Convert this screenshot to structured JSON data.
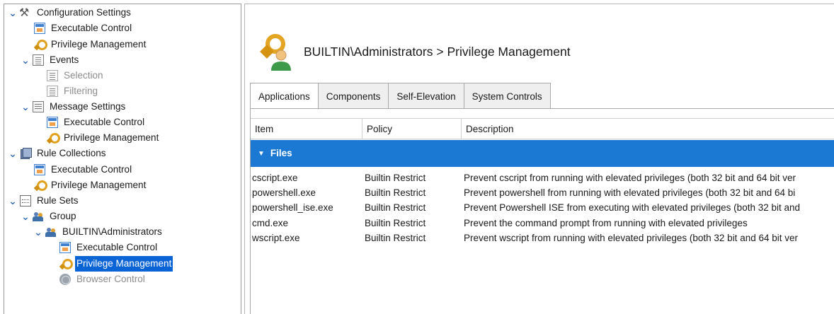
{
  "tree": {
    "items": [
      {
        "label": "Configuration Settings",
        "icon": "tools-icon",
        "level": 0,
        "expanded": true
      },
      {
        "label": "Executable Control",
        "icon": "executable-control-icon",
        "level": 1
      },
      {
        "label": "Privilege Management",
        "icon": "privilege-key-icon",
        "level": 1
      },
      {
        "label": "Events",
        "icon": "events-document-icon",
        "level": 1,
        "expanded": true
      },
      {
        "label": "Selection",
        "icon": "document-icon",
        "level": 2,
        "dim": true
      },
      {
        "label": "Filtering",
        "icon": "document-icon",
        "level": 2,
        "dim": true
      },
      {
        "label": "Message Settings",
        "icon": "message-settings-icon",
        "level": 1,
        "expanded": true
      },
      {
        "label": "Executable Control",
        "icon": "executable-control-icon",
        "level": 2
      },
      {
        "label": "Privilege Management",
        "icon": "privilege-key-icon",
        "level": 2
      },
      {
        "label": "Rule Collections",
        "icon": "rule-collections-icon",
        "level": 0,
        "expanded": true
      },
      {
        "label": "Executable Control",
        "icon": "executable-control-icon",
        "level": 1
      },
      {
        "label": "Privilege Management",
        "icon": "privilege-key-icon",
        "level": 1
      },
      {
        "label": "Rule Sets",
        "icon": "rule-sets-icon",
        "level": 0,
        "expanded": true
      },
      {
        "label": "Group",
        "icon": "group-icon",
        "level": 1,
        "expanded": true
      },
      {
        "label": "BUILTIN\\Administrators",
        "icon": "group-icon",
        "level": 2,
        "expanded": true
      },
      {
        "label": "Executable Control",
        "icon": "executable-control-icon",
        "level": 3
      },
      {
        "label": "Privilege Management",
        "icon": "privilege-key-icon",
        "level": 3,
        "selected": true
      },
      {
        "label": "Browser Control",
        "icon": "browser-globe-icon",
        "level": 3,
        "dim": true
      }
    ]
  },
  "header": {
    "title": "BUILTIN\\Administrators > Privilege Management",
    "icon": "privilege-management-key-user-icon"
  },
  "tabs": [
    {
      "label": "Applications",
      "active": true
    },
    {
      "label": "Components"
    },
    {
      "label": "Self-Elevation"
    },
    {
      "label": "System Controls"
    }
  ],
  "grid": {
    "columns": [
      "Item",
      "Policy",
      "Description"
    ],
    "group": {
      "label": "Files",
      "expanded": true
    },
    "rows": [
      {
        "item": "cscript.exe",
        "policy": "Builtin Restrict",
        "description": "Prevent cscript from running with elevated privileges (both 32 bit and 64 bit ver"
      },
      {
        "item": "powershell.exe",
        "policy": "Builtin Restrict",
        "description": "Prevent powershell from running with elevated privileges (both 32 bit and 64 bi"
      },
      {
        "item": "powershell_ise.exe",
        "policy": "Builtin Restrict",
        "description": "Prevent Powershell ISE from executing with elevated privileges (both 32 bit and"
      },
      {
        "item": "cmd.exe",
        "policy": "Builtin Restrict",
        "description": "Prevent the command prompt from running with elevated privileges"
      },
      {
        "item": "wscript.exe",
        "policy": "Builtin Restrict",
        "description": "Prevent wscript from running with elevated privileges (both 32 bit and 64 bit ver"
      }
    ]
  },
  "colors": {
    "selection": "#0a64d6",
    "group_row": "#1c79d3",
    "expander": "#3a6fb5"
  }
}
